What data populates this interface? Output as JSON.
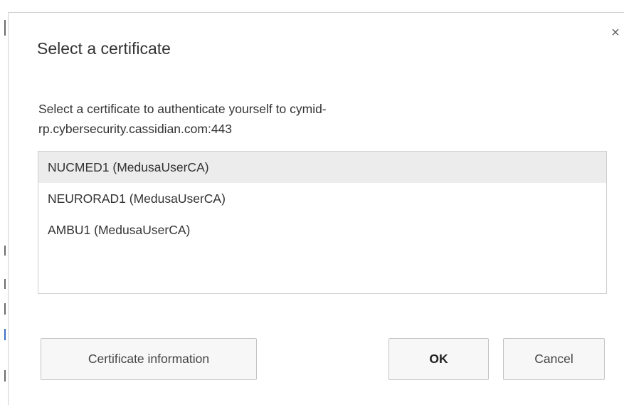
{
  "dialog": {
    "title": "Select a certificate",
    "close_symbol": "×",
    "message": "Select a certificate to authenticate yourself to cymid-rp.cybersecurity.cassidian.com:443",
    "certificates": [
      {
        "label": "NUCMED1 (MedusaUserCA)",
        "selected": true
      },
      {
        "label": "NEURORAD1 (MedusaUserCA)",
        "selected": false
      },
      {
        "label": "AMBU1 (MedusaUserCA)",
        "selected": false
      }
    ],
    "buttons": {
      "certificate_info": "Certificate information",
      "ok": "OK",
      "cancel": "Cancel"
    }
  },
  "colors": {
    "selected_row": "#ececec",
    "list_border": "#cfcfcf",
    "button_bg": "#f7f7f7",
    "text": "#333333"
  },
  "icons": {
    "close": "close-icon"
  }
}
